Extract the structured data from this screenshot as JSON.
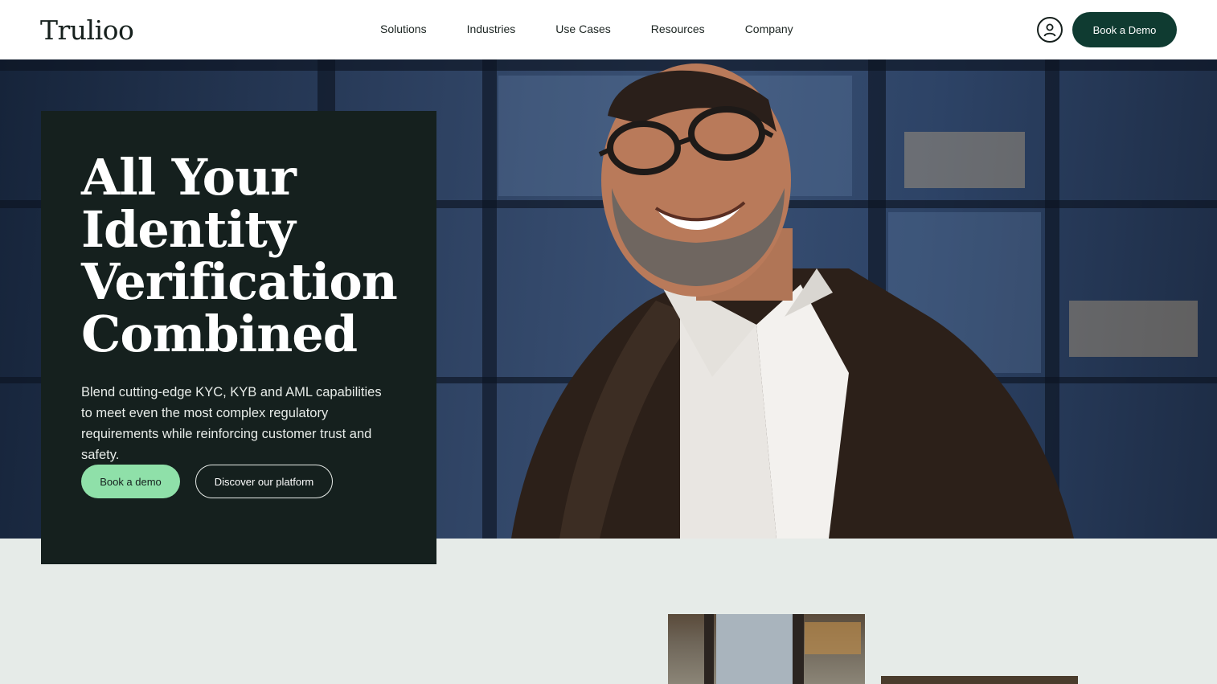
{
  "header": {
    "logo": "Trulioo",
    "nav": [
      "Solutions",
      "Industries",
      "Use Cases",
      "Resources",
      "Company"
    ],
    "account_icon": "user-icon",
    "demo_button": "Book a Demo"
  },
  "hero": {
    "title_lines": [
      "All Your",
      "Identity",
      "Verification",
      "Combined"
    ],
    "description": "Blend cutting-edge KYC, KYB and AML capabilities to meet even the most complex regulatory requirements while reinforcing customer trust and safety.",
    "primary_button": "Book a demo",
    "secondary_button": "Discover our platform"
  },
  "colors": {
    "brand_dark": "#0f3b31",
    "card_bg": "#15201e",
    "accent_green": "#8fe0a9",
    "page_bg": "#e6ebe8"
  }
}
